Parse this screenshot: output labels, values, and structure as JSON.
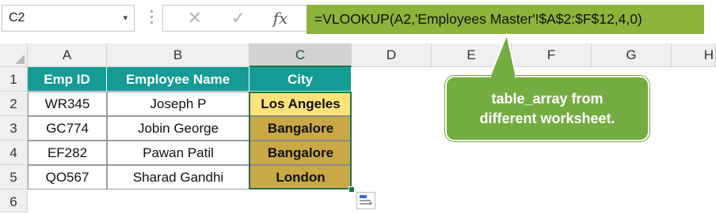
{
  "formula_bar": {
    "name_box": "C2",
    "name_box_dropdown_glyph": "▾",
    "cancel_glyph": "✕",
    "enter_glyph": "✓",
    "fx_label": "fx",
    "formula": "=VLOOKUP(A2,'Employees Master'!$A$2:$F$12,4,0)"
  },
  "columns": [
    "A",
    "B",
    "C",
    "D",
    "E",
    "F",
    "G",
    "H"
  ],
  "rows": [
    "1",
    "2",
    "3",
    "4",
    "5",
    "6"
  ],
  "table": {
    "headers": [
      "Emp ID",
      "Employee Name",
      "City"
    ],
    "rows": [
      {
        "emp_id": "WR345",
        "name": "Joseph P",
        "city": "Los Angeles"
      },
      {
        "emp_id": "GC774",
        "name": "Jobin George",
        "city": "Bangalore"
      },
      {
        "emp_id": "EF282",
        "name": "Pawan Patil",
        "city": "Bangalore"
      },
      {
        "emp_id": "QO567",
        "name": "Sharad Gandhi",
        "city": "London"
      }
    ]
  },
  "callout": {
    "line1": "table_array from",
    "line2": "different worksheet."
  },
  "colors": {
    "formula_highlight": "#8cb43a",
    "header_fill": "#149b94",
    "city_fill": "#c9a848",
    "city_first_fill": "#fde27a",
    "callout_fill": "#74ac42",
    "selection": "#217346"
  },
  "icons": {
    "name_box_dropdown": "chevron-down-icon",
    "cancel": "close-icon",
    "enter": "checkmark-icon",
    "function": "fx-icon",
    "quick_analysis": "quick-analysis-icon"
  }
}
